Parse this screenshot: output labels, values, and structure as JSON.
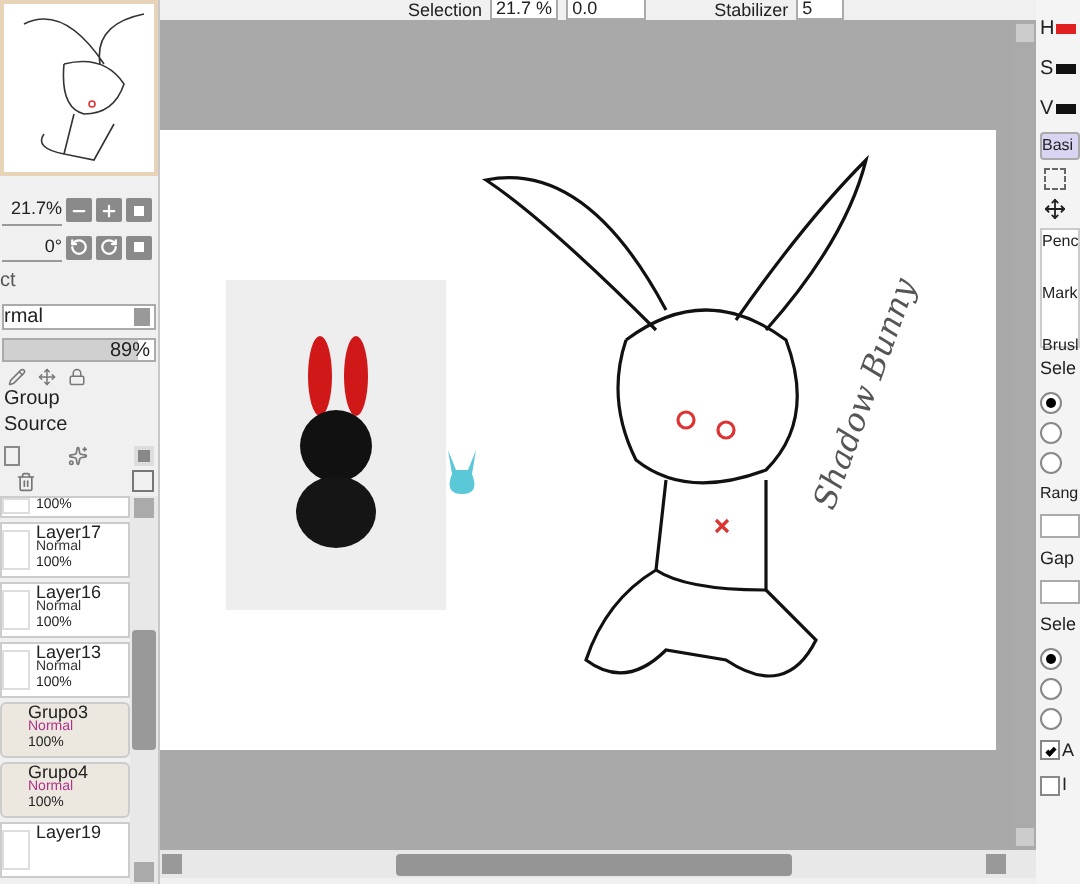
{
  "toolbar": {
    "selection_label": "Selection",
    "zoom": "21.7 %",
    "angle": "0.0",
    "stabilizer_label": "Stabilizer",
    "stabilizer": "5"
  },
  "navigator": {
    "zoom": "21.7%",
    "angle": "0°"
  },
  "layer_panel": {
    "effect_label": "ct",
    "blend_mode": "rmal",
    "opacity": {
      "reading": "89%",
      "level": 0.89
    },
    "options": [
      {
        "label": "Group"
      },
      {
        "label": "Source"
      }
    ]
  },
  "layers": [
    {
      "kind": "layer",
      "opacity": "100%"
    },
    {
      "kind": "layer",
      "name": "Layer17",
      "mode": "Normal",
      "opacity": "100%"
    },
    {
      "kind": "layer",
      "name": "Layer16",
      "mode": "Normal",
      "opacity": "100%"
    },
    {
      "kind": "layer",
      "name": "Layer13",
      "mode": "Normal",
      "opacity": "100%"
    },
    {
      "kind": "group",
      "name": "Grupo3",
      "mode": "Normal",
      "opacity": "100%"
    },
    {
      "kind": "group",
      "name": "Grupo4",
      "mode": "Normal",
      "opacity": "100%"
    },
    {
      "kind": "layer",
      "name": "Layer19"
    }
  ],
  "canvas": {
    "signature": "Shadow Bunny"
  },
  "color_panel": {
    "channels": [
      {
        "label": "H",
        "color": "#e02020"
      },
      {
        "label": "S",
        "color": "#111111"
      },
      {
        "label": "V",
        "color": "#111111"
      }
    ],
    "tab": "Basi"
  },
  "tool_panel": {
    "tools": [
      "Penc",
      "Mark",
      "Brusl"
    ],
    "select_label_1": "Sele",
    "radios_1": [
      {
        "selected": true
      },
      {
        "selected": false
      },
      {
        "selected": false
      }
    ],
    "range_label": "Rang",
    "gap_label": "Gap",
    "select_label_2": "Sele",
    "radios_2": [
      {
        "selected": true
      },
      {
        "selected": false
      },
      {
        "selected": false
      }
    ],
    "checks": [
      {
        "label": "A",
        "checked": true
      },
      {
        "label": "I",
        "checked": false
      }
    ]
  }
}
